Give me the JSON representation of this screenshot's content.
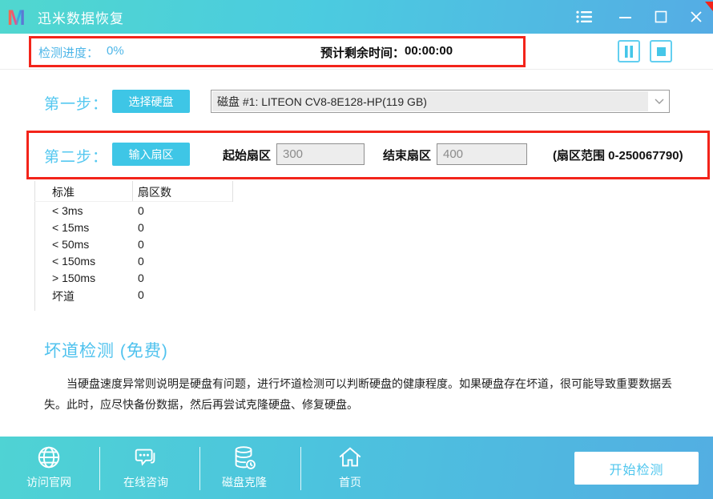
{
  "titlebar": {
    "app_title": "迅米数据恢复",
    "logo_icon": "brand-m-logo",
    "control_icons": [
      "menu-list-icon",
      "minimize-icon",
      "maximize-icon",
      "close-icon"
    ]
  },
  "progress": {
    "label": "检测进度：",
    "value": "0%",
    "eta_label": "预计剩余时间：",
    "eta_value": "00:00:00",
    "pause_icon": "pause-icon",
    "stop_icon": "stop-icon"
  },
  "step1": {
    "label": "第一步：",
    "action_button": "选择硬盘",
    "disk_dropdown_value": "磁盘 #1: LITEON CV8-8E128-HP(119 GB)"
  },
  "step2": {
    "label": "第二步：",
    "action_button": "输入扇区",
    "start_sector_label": "起始扇区",
    "start_sector_value": "300",
    "end_sector_label": "结束扇区",
    "end_sector_value": "400",
    "sector_range_note": "(扇区范围 0-250067790)"
  },
  "speed_table": {
    "headers": [
      "标准",
      "扇区数"
    ],
    "rows": [
      {
        "label": "< 3ms",
        "value": "0"
      },
      {
        "label": "< 15ms",
        "value": "0"
      },
      {
        "label": "< 50ms",
        "value": "0"
      },
      {
        "label": "< 150ms",
        "value": "0"
      },
      {
        "label": "> 150ms",
        "value": "0"
      },
      {
        "label": "坏道",
        "value": "0"
      }
    ]
  },
  "bad_sector_section": {
    "heading": "坏道检测 (免费)",
    "description": "当硬盘速度异常则说明是硬盘有问题，进行坏道检测可以判断硬盘的健康程度。如果硬盘存在坏道，很可能导致重要数据丢失。此时，应尽快备份数据，然后再尝试克隆硬盘、修复硬盘。"
  },
  "footer": {
    "nav": [
      {
        "label": "访问官网",
        "icon": "globe-icon"
      },
      {
        "label": "在线咨询",
        "icon": "chat-icon"
      },
      {
        "label": "磁盘克隆",
        "icon": "disk-clone-icon"
      },
      {
        "label": "首页",
        "icon": "home-icon"
      }
    ],
    "start_button": "开始检测"
  },
  "colors": {
    "accent": "#3ec6e6",
    "teal_text": "#4fc2ee",
    "titlebar_gradient_left": "#50d7cf",
    "titlebar_gradient_right": "#55ace4",
    "annotation_red": "#f3241a",
    "input_disabled_bg": "#ededed"
  }
}
